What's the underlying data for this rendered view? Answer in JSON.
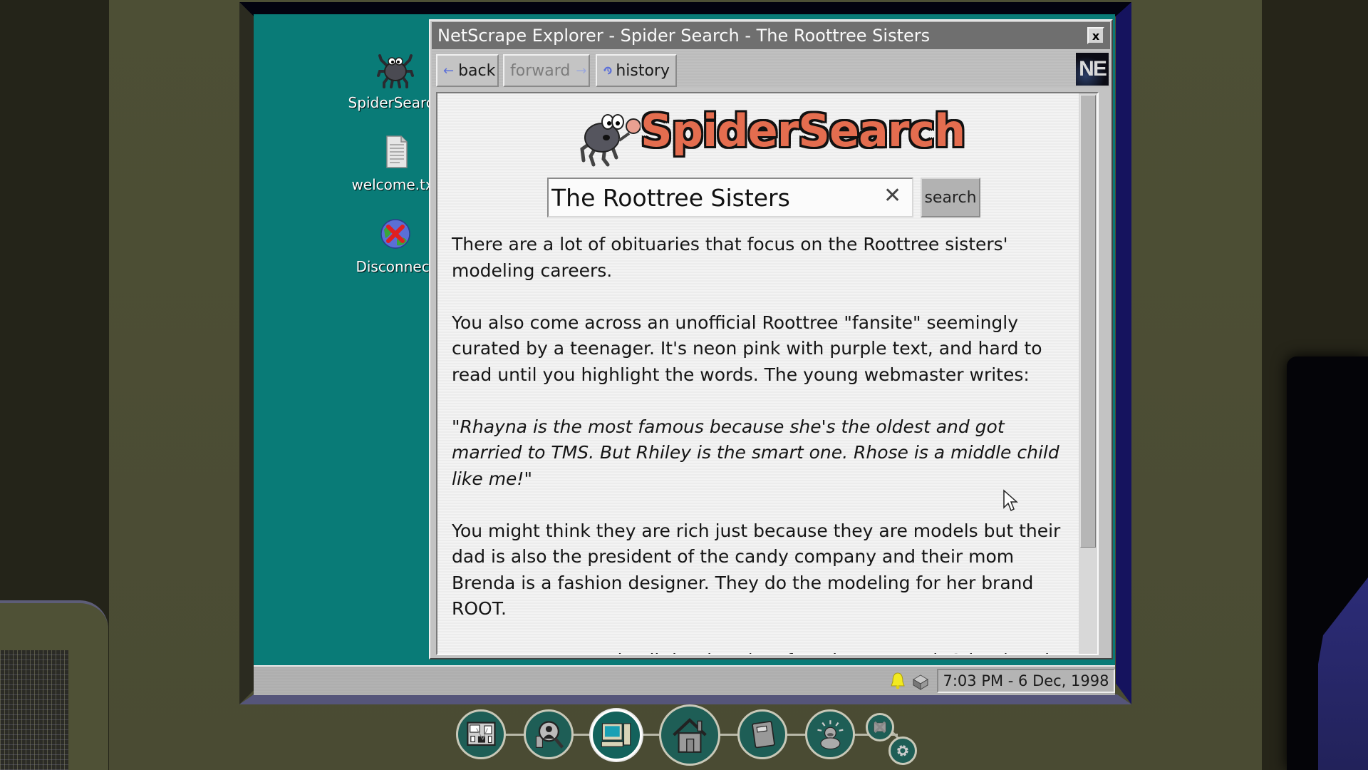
{
  "desktop": {
    "icons": [
      {
        "label": "SpiderSearch",
        "icon": "spider-icon"
      },
      {
        "label": "welcome.txt",
        "icon": "text-file-icon"
      },
      {
        "label": "Disconnect",
        "icon": "disconnect-globe-icon"
      }
    ]
  },
  "browser": {
    "title": "NetScrape Explorer - Spider Search - The Roottree Sisters",
    "close_label": "x",
    "toolbar": {
      "back_label": "back",
      "forward_label": "forward",
      "history_label": "history",
      "back_arrow": "←",
      "forward_arrow": "→",
      "logo_text": "NE"
    },
    "page": {
      "logo_text": "SpiderSearch",
      "search_value": "The Roottree Sisters",
      "clear_label": "✕",
      "search_button": "search",
      "paragraphs": [
        {
          "text": "There are a lot of obituaries that focus on the Roottree sisters' modeling careers.",
          "style": "normal"
        },
        {
          "text": "You also come across an unofficial Roottree \"fansite\" seemingly curated by a teenager. It's neon pink with purple text, and hard to read until you highlight the words. The young webmaster writes:",
          "style": "normal"
        },
        {
          "text": "\"Rhayna is the most famous because she's the oldest and got married to TMS. But Rhiley is the smart one. Rhose is a middle child like me!\"",
          "style": "italic"
        },
        {
          "text": "You might think they are rich just because they are models but their dad is also the president of the candy company and their mom Brenda is a fashion designer. They do the modeling for her brand ROOT.",
          "style": "normal"
        },
        {
          "text": "I eat Roottree candy all the time (my favorite are MapleCrisps) and try to dress in old ROOT clothes like Rhiley does in most of the",
          "style": "normal"
        }
      ],
      "scroll_position_fraction": 0.0,
      "scroll_visible_fraction": 0.81
    }
  },
  "taskbar": {
    "clock": "7:03 PM - 6 Dec, 1998",
    "tray_icons": [
      "bell-icon",
      "disk-drive-icon"
    ]
  },
  "dock": {
    "items": [
      {
        "name": "evidence-board",
        "icon": "corkboard-icon",
        "active": false
      },
      {
        "name": "search-profile",
        "icon": "magnifier-person-icon",
        "active": false
      },
      {
        "name": "computer",
        "icon": "computer-icon",
        "active": true
      },
      {
        "name": "home",
        "icon": "house-icon",
        "active": false
      },
      {
        "name": "notebook",
        "icon": "notebook-icon",
        "active": false
      },
      {
        "name": "duck-hint",
        "icon": "duck-icon",
        "active": false
      },
      {
        "name": "disable-photos",
        "icon": "photo-crossed-icon",
        "active": false
      },
      {
        "name": "settings",
        "icon": "gear-icon",
        "active": false
      }
    ]
  },
  "colors": {
    "desktop_teal": "#097b77",
    "logo_orange": "#e46d4f",
    "room_olive": "#4b4c34",
    "bezel_blue": "#15135e"
  }
}
